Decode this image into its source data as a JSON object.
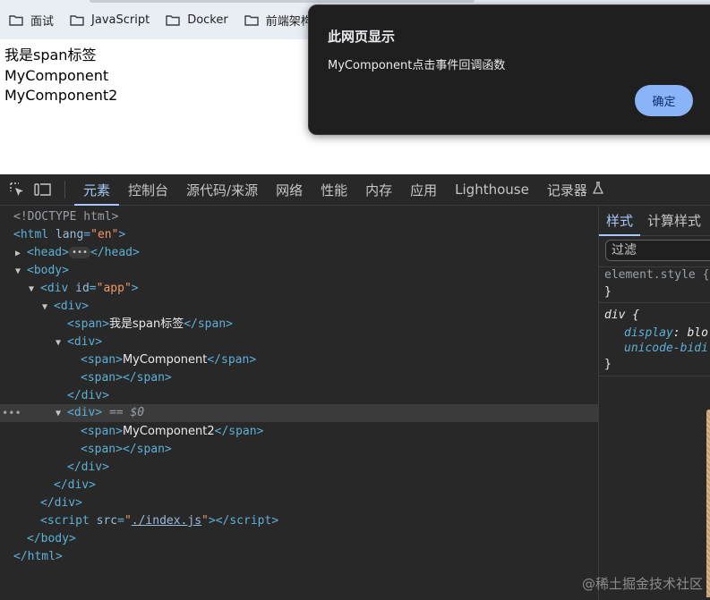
{
  "bookmarks": [
    {
      "label": "面试"
    },
    {
      "label": "JavaScript"
    },
    {
      "label": "Docker"
    },
    {
      "label": "前端架构"
    }
  ],
  "page": {
    "lines": [
      "我是span标签",
      "MyComponent",
      "MyComponent2"
    ]
  },
  "alert": {
    "title": "此网页显示",
    "message": "MyComponent点击事件回调函数",
    "ok_label": "确定"
  },
  "devtools": {
    "tabs": [
      "元素",
      "控制台",
      "源代码/来源",
      "网络",
      "性能",
      "内存",
      "应用",
      "Lighthouse",
      "记录器"
    ],
    "active_tab": "元素",
    "dom": {
      "doctype": "<!DOCTYPE html>",
      "html_tag": "html",
      "lang_attr": "lang",
      "lang_value": "en",
      "head_open": "<head>",
      "head_close": "</head>",
      "body_open": "<body>",
      "div_app_attr": "id",
      "div_app_value": "app",
      "span_text_1": "我是span标签",
      "span_text_2": "MyComponent",
      "span_text_3": "MyComponent2",
      "selected_marker": "== $0",
      "script_src_attr": "src",
      "script_src_value": "./index.js",
      "body_close": "</body>",
      "html_close": "</html>"
    },
    "styles": {
      "tabs": [
        "样式",
        "计算样式"
      ],
      "filter_placeholder": "过滤",
      "element_style": "element.style {",
      "close_brace": "}",
      "div_selector": "div {",
      "prop_1": "display",
      "val_1": "blo",
      "prop_2": "unicode-bidi"
    }
  },
  "watermark": "@稀土掘金技术社区",
  "colors": {
    "accent": "#a8c7fa",
    "tag": "#5db0d7",
    "attr_value": "#f29766",
    "alert_button": "#8ab4f8"
  }
}
